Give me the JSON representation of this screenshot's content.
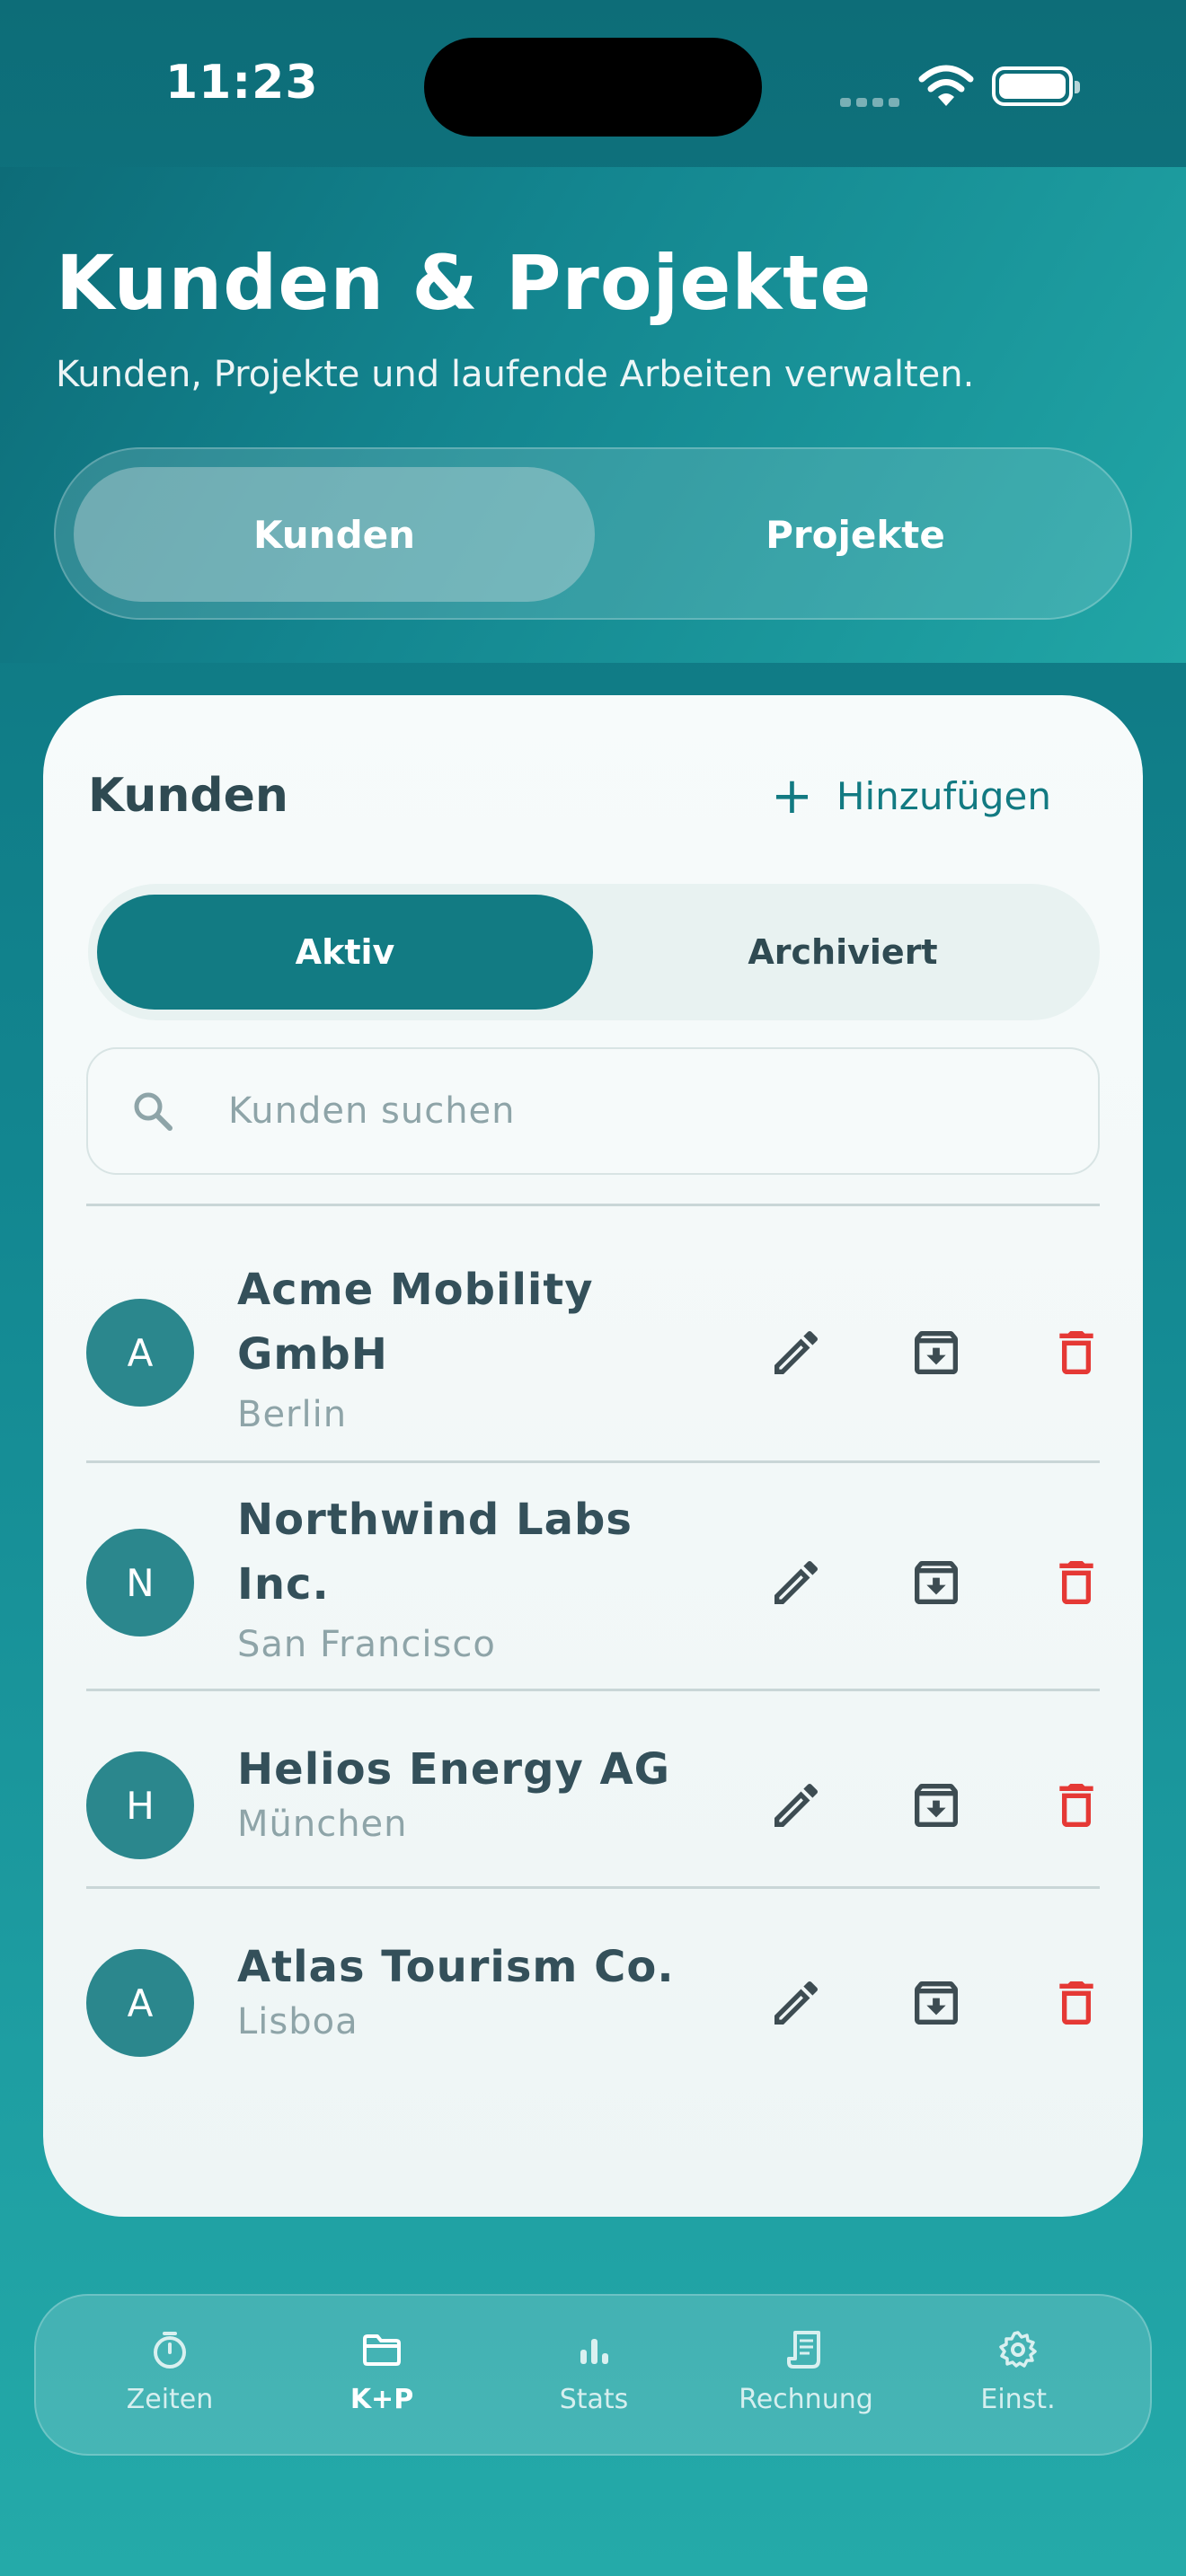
{
  "status": {
    "time": "11:23"
  },
  "header": {
    "title": "Kunden & Projekte",
    "subtitle": "Kunden, Projekte und laufende Arbeiten verwalten.",
    "segments": [
      "Kunden",
      "Projekte"
    ],
    "active_segment": "Kunden"
  },
  "card": {
    "title": "Kunden",
    "add_label": "Hinzufügen",
    "filters": [
      "Aktiv",
      "Archiviert"
    ],
    "active_filter": "Aktiv",
    "search_placeholder": "Kunden suchen",
    "clients": [
      {
        "initial": "A",
        "name": "Acme Mobility GmbH",
        "city": "Berlin"
      },
      {
        "initial": "N",
        "name": "Northwind Labs Inc.",
        "city": "San Francisco"
      },
      {
        "initial": "H",
        "name": "Helios Energy AG",
        "city": "München"
      },
      {
        "initial": "A",
        "name": "Atlas Tourism Co.",
        "city": "Lisboa"
      }
    ],
    "icons": {
      "edit": "pencil-icon",
      "archive": "archive-icon",
      "delete": "trash-icon"
    }
  },
  "tabbar": {
    "items": [
      {
        "label": "Zeiten",
        "icon": "stopwatch-icon"
      },
      {
        "label": "K+P",
        "icon": "folder-icon"
      },
      {
        "label": "Stats",
        "icon": "bar-chart-icon"
      },
      {
        "label": "Rechnung",
        "icon": "invoice-icon"
      },
      {
        "label": "Einst.",
        "icon": "gear-icon"
      }
    ],
    "active": "K+P"
  },
  "colors": {
    "accent": "#127b83",
    "danger": "#e53935",
    "text": "#2f4a52",
    "muted": "#8ea4a8"
  }
}
